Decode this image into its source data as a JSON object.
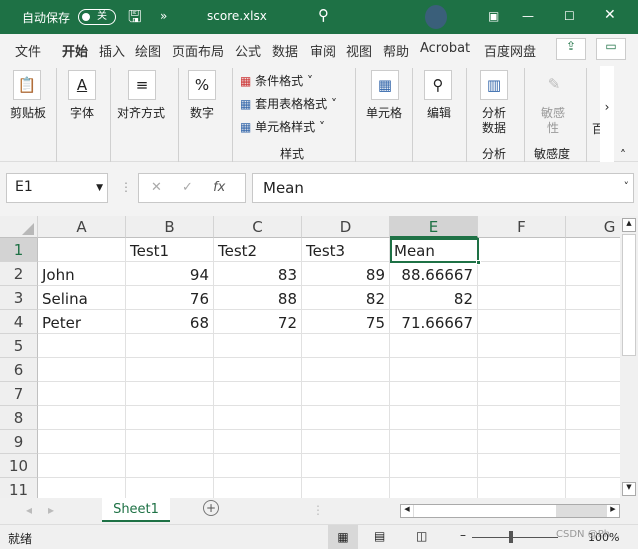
{
  "title": {
    "autosave": "自动保存",
    "toggle": "关",
    "filename": "score.xlsx"
  },
  "tabs": [
    "文件",
    "开始",
    "插入",
    "绘图",
    "页面布局",
    "公式",
    "数据",
    "审阅",
    "视图",
    "帮助",
    "Acrobat",
    "百度网盘"
  ],
  "ribbon": {
    "clipboard": "剪贴板",
    "font": "字体",
    "align": "对齐方式",
    "number": "数字",
    "cond": "条件格式",
    "table": "套用表格格式",
    "cellstyle": "单元格样式",
    "styles": "样式",
    "cells": "单元格",
    "edit": "编辑",
    "analyze1": "分析",
    "analyze2": "数据",
    "analyze_group": "分析",
    "sens1": "敏感",
    "sens2": "性",
    "sens_group": "敏感度",
    "more": "百"
  },
  "formula": {
    "namebox": "E1",
    "fx": "fx",
    "value": "Mean"
  },
  "columns": [
    "A",
    "B",
    "C",
    "D",
    "E",
    "F",
    "G"
  ],
  "rows": [
    "1",
    "2",
    "3",
    "4",
    "5",
    "6",
    "7",
    "8",
    "9",
    "10",
    "11"
  ],
  "cells": [
    [
      "",
      "Test1",
      "Test2",
      "Test3",
      "Mean"
    ],
    [
      "John",
      "94",
      "83",
      "89",
      "88.66667"
    ],
    [
      "Selina",
      "76",
      "88",
      "82",
      "82"
    ],
    [
      "Peter",
      "68",
      "72",
      "75",
      "71.66667"
    ]
  ],
  "sheet": "Sheet1",
  "status": {
    "ready": "就绪",
    "zoom": "100%",
    "watermark": "CSDN @Ph..."
  }
}
